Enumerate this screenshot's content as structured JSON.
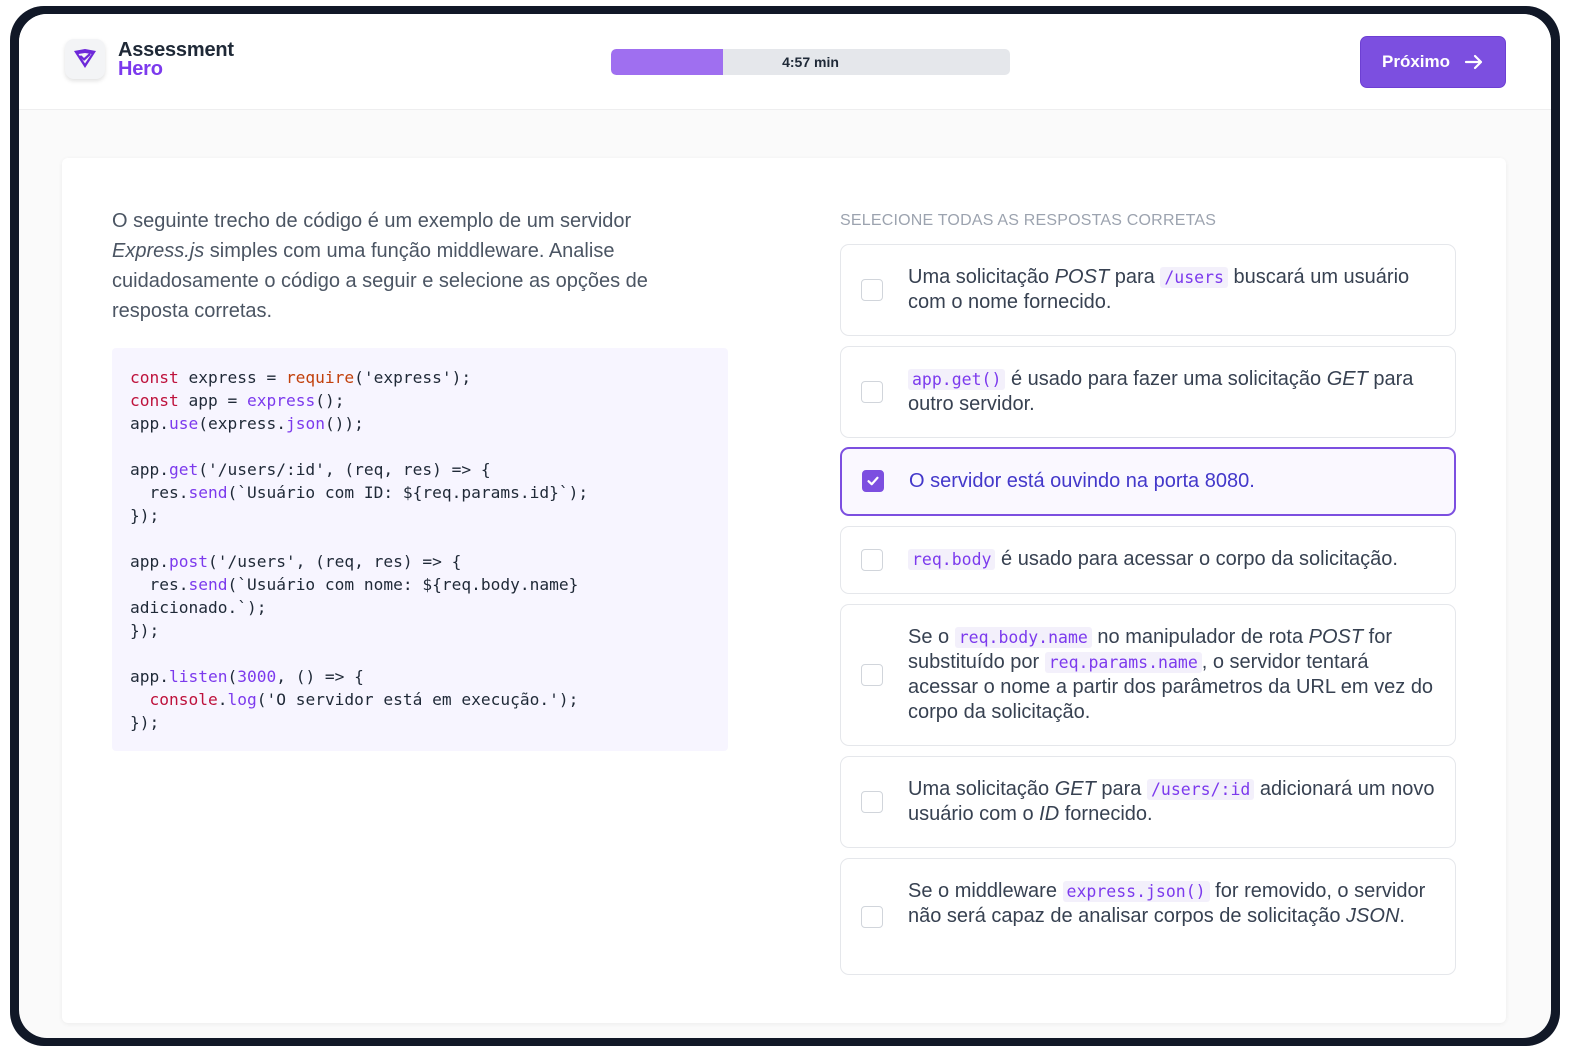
{
  "header": {
    "logo_line1": "Assessment",
    "logo_line2": "Hero",
    "timer_label": "4:57 min",
    "timer_progress": 0.28,
    "next_label": "Próximo"
  },
  "colors": {
    "accent": "#7c4fe0",
    "progress_fill": "#9f6ff0",
    "code_background": "#f7f5ff"
  },
  "icons": {
    "logo": "shield-check-icon",
    "next": "arrow-right-icon",
    "check": "check-icon"
  },
  "question": {
    "part1": "O seguinte trecho de código é um exemplo de um servidor ",
    "part2_italic": "Express.js",
    "part3": " simples com uma função middleware. Analise cuidadosamente o código a seguir e selecione as opções de resposta corretas."
  },
  "code": {
    "l1a": "const",
    "l1b": " express = ",
    "l1c": "require",
    "l1d": "('express');",
    "l2a": "const",
    "l2b": " app = ",
    "l2c": "express",
    "l2d": "();",
    "l3a": "app.",
    "l3b": "use",
    "l3c": "(express.",
    "l3d": "json",
    "l3e": "());",
    "l4a": "app.",
    "l4b": "get",
    "l4c": "('/users/:id', (req, res) => {",
    "l5a": "  res.",
    "l5b": "send",
    "l5c": "(`Usuário com ID: ${req.params.id}`);",
    "l6": "});",
    "l7a": "app.",
    "l7b": "post",
    "l7c": "('/users', (req, res) => {",
    "l8a": "  res.",
    "l8b": "send",
    "l8c": "(`Usuário com nome: ${req.body.name}",
    "l9": "adicionado.`);",
    "l10": "});",
    "l11a": "app.",
    "l11b": "listen",
    "l11c": "(",
    "l11d": "3000",
    "l11e": ", () => {",
    "l12a": "  console",
    "l12b": ".",
    "l12c": "log",
    "l12d": "('O servidor está em execução.');",
    "l13": "});"
  },
  "answers": {
    "label": "SELECIONE TODAS AS RESPOSTAS CORRETAS",
    "o1": {
      "a": "Uma solicitação ",
      "b": "POST",
      "c": " para ",
      "code": "/users",
      "d": " buscará um usuário com o nome fornecido.",
      "checked": false
    },
    "o2": {
      "code": "app.get()",
      "a": " é usado para fazer uma solicitação ",
      "b": "GET",
      "c": " para outro servidor.",
      "checked": false
    },
    "o3": {
      "a": "O servidor está ouvindo na porta 8080.",
      "checked": true
    },
    "o4": {
      "code": "req.body",
      "a": " é usado para acessar o corpo da solicitação.",
      "checked": false
    },
    "o5": {
      "a": "Se o ",
      "code1": "req.body.name",
      "b": " no manipulador de rota ",
      "c": "POST",
      "d": " for substituído por ",
      "code2": "req.params.name",
      "e": ", o servidor tentará acessar o nome a partir dos parâmetros da URL em vez do corpo da solicitação.",
      "checked": false
    },
    "o6": {
      "a": "Uma solicitação ",
      "b": "GET",
      "c": " para ",
      "code": "/users/:id",
      "d": " adicionará um novo usuário com o ",
      "e": "ID",
      "f": " fornecido.",
      "checked": false
    },
    "o7": {
      "a": "Se o middleware ",
      "code": "express.json()",
      "b": " for removido, o servidor não será capaz de analisar corpos de solicitação ",
      "c": "JSON",
      "d": ".",
      "checked": false
    }
  }
}
